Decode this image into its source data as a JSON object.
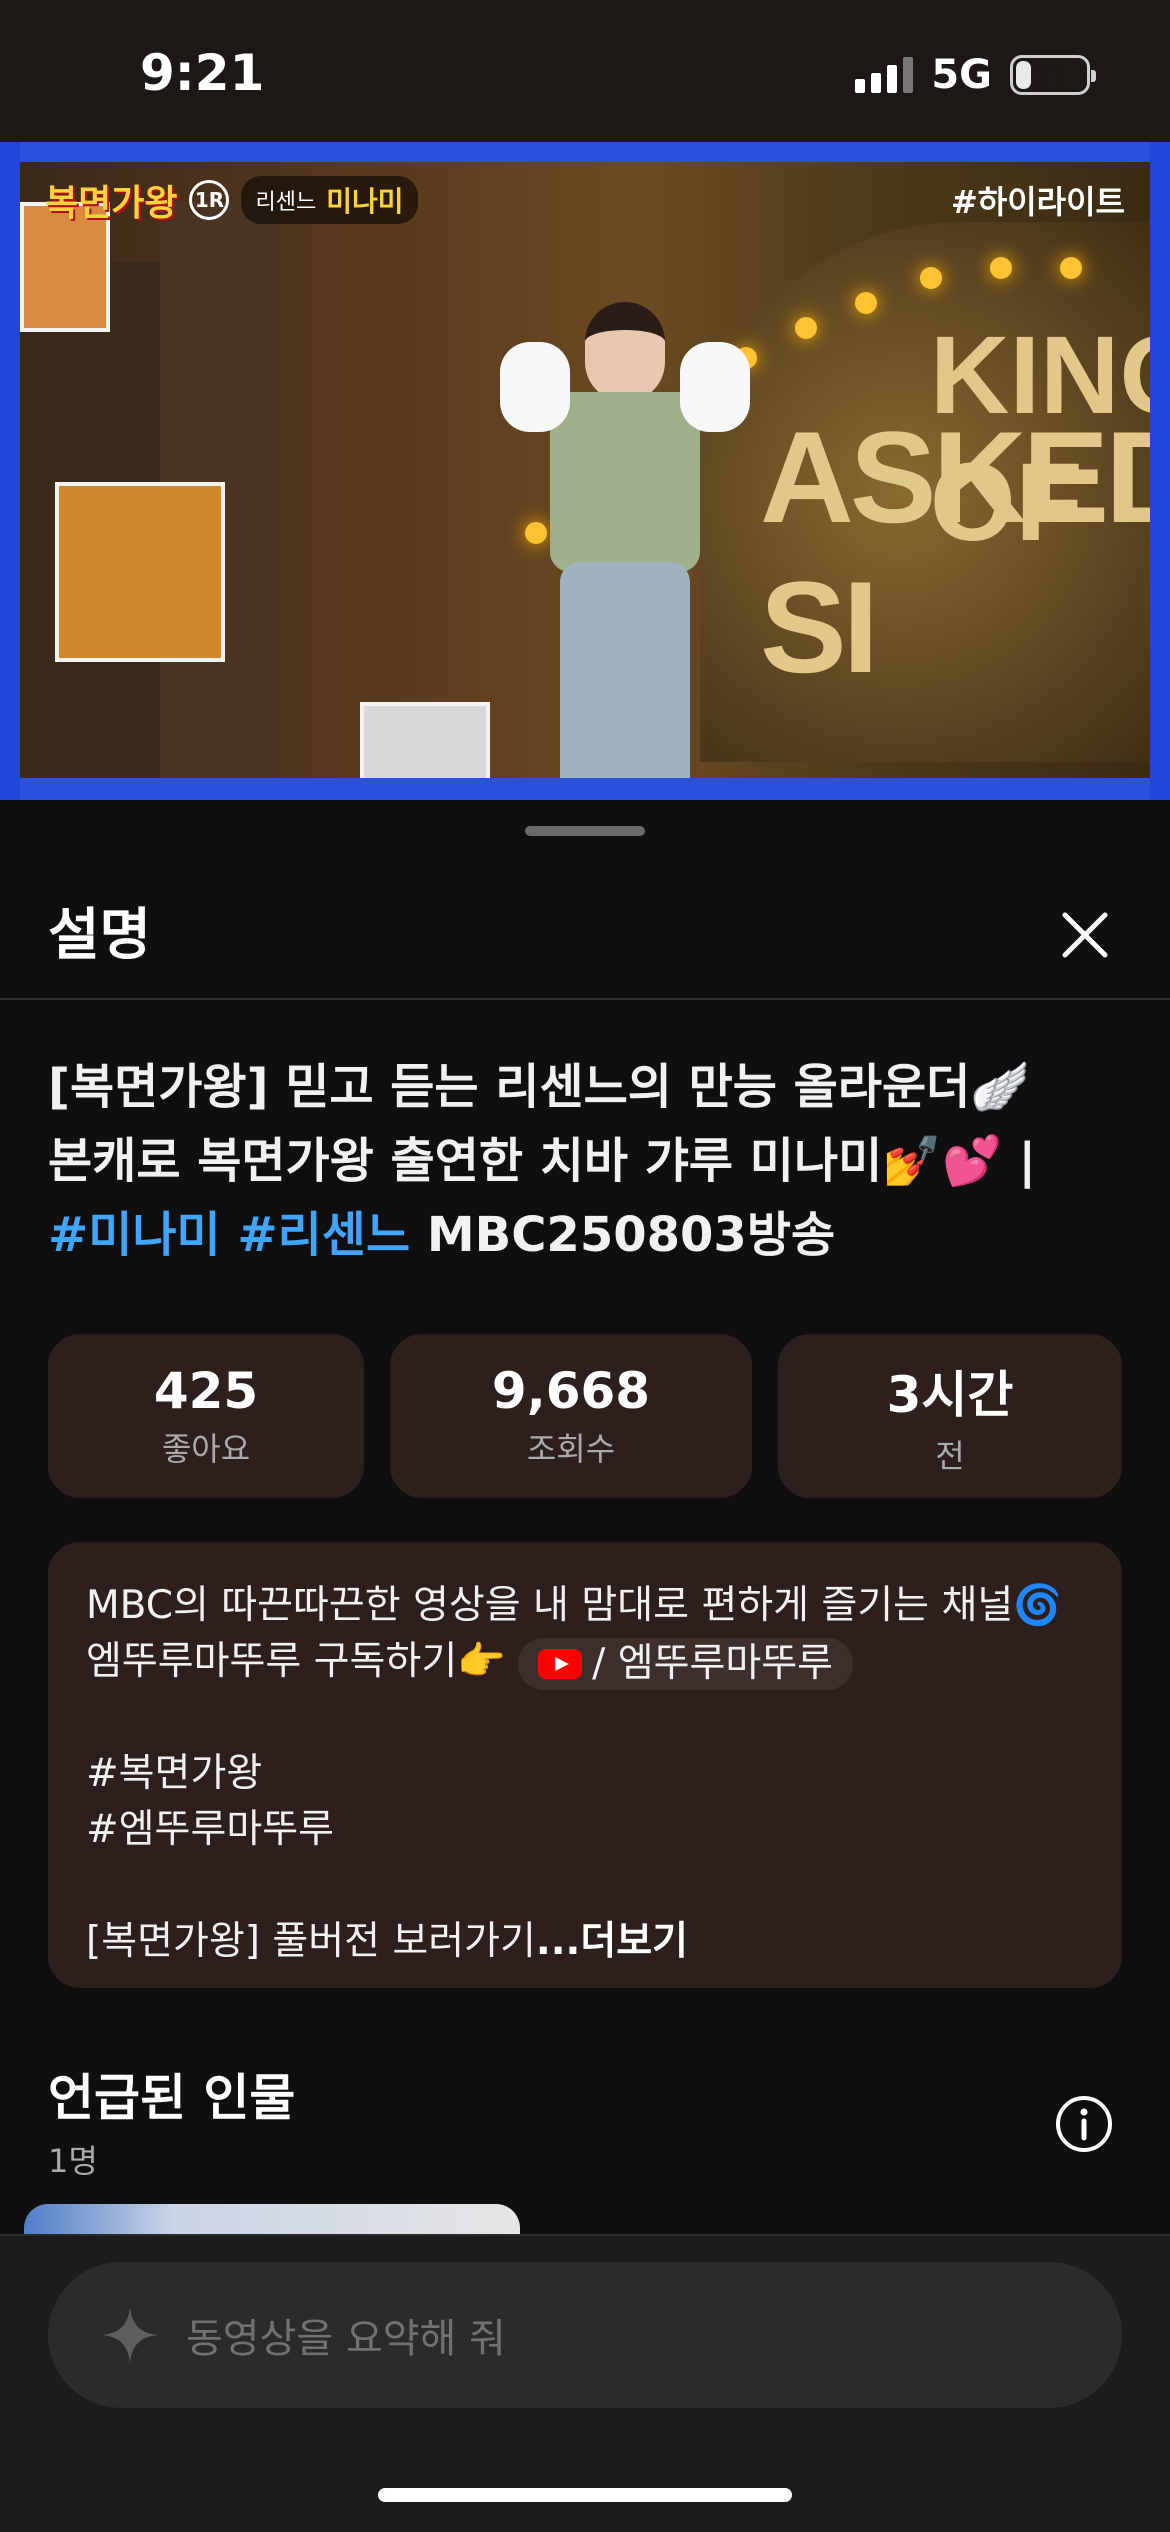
{
  "status": {
    "time": "9:21",
    "network": "5G",
    "battery": "21",
    "battery_level_percent": 21
  },
  "video": {
    "badge": "#하이라이트",
    "logo_text": "복면가왕",
    "round": "1R",
    "group": "리센느",
    "contestant": "미나미",
    "sign_top": "KING OF",
    "sign_main": "ASKED SI"
  },
  "sheet": {
    "title": "설명",
    "video_title_line1": "[복면가왕] 믿고 듣는 리센느의 만능 올라운더🪽",
    "video_title_line2": "본캐로 복면가왕 출연한 치바 갸루 미나미💅💕 |",
    "hashtag1": "#미나미",
    "hashtag2": "#리센느",
    "title_suffix": "MBC250803방송",
    "stats": [
      {
        "value": "425",
        "label": "좋아요"
      },
      {
        "value": "9,668",
        "label": "조회수"
      },
      {
        "value": "3시간",
        "label": "전"
      }
    ],
    "description": {
      "line1": "MBC의 따끈따끈한 영상을 내 맘대로 편하게 즐기는 채널🌀",
      "line2": "엠뚜루마뚜루 구독하기👉",
      "chip_label": "/ 엠뚜루마뚜루",
      "tag1": "#복면가왕",
      "tag2": "#엠뚜루마뚜루",
      "line3": "[복면가왕] 풀버전 보러가기",
      "more": "...더보기"
    },
    "people": {
      "title": "언급된 인물",
      "count": "1명"
    },
    "ask_placeholder": "동영상을 요약해 줘"
  }
}
